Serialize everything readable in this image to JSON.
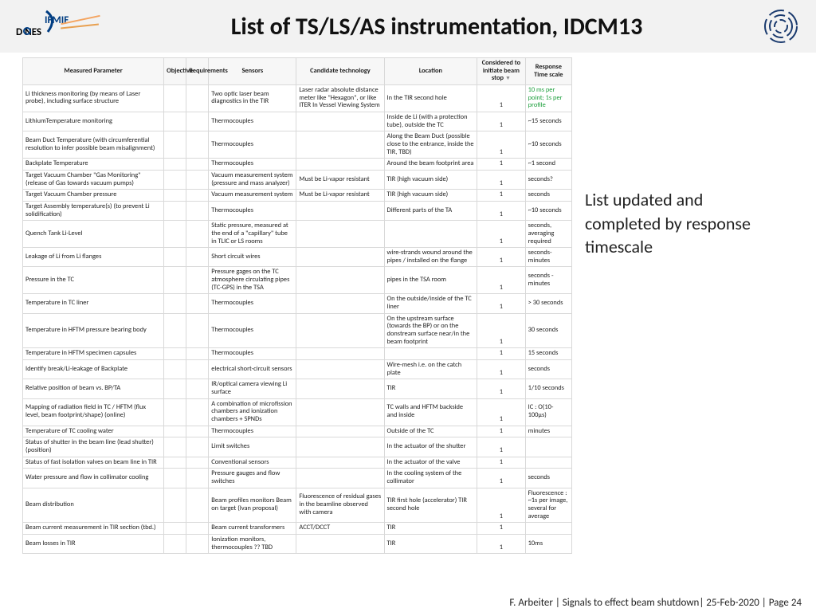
{
  "header": {
    "title": "List of TS/LS/AS instrumentation, IDCM13"
  },
  "sideNote": "List updated and completed by response timescale",
  "footer": "F. Arbeiter | Signals to effect beam shutdown| 25-Feb-2020 | Page 24",
  "logo": {
    "ifmif": "IFMIF",
    "dones": "D   NES"
  },
  "columns": {
    "c1": "Measured Parameter",
    "c2": "Objective",
    "c3": "Requirements",
    "c4": "Sensors",
    "c5": "Candidate technology",
    "c6": "Location",
    "c7": "Considered to initiate beam stop",
    "c8": "Response Time scale"
  },
  "rows": [
    {
      "p": "Li thickness monitoring  (by means of Laser probe), including surface structure",
      "s": "Two optic laser beam diagnostics in the TIR",
      "t": "Laser radar absolute distance meter like \"Hexagon\", or like ITER In Vessel Viewing System",
      "l": "In the TIR second hole",
      "b": "1",
      "r": "10 ms per point; 1s per profile",
      "g": true
    },
    {
      "p": "LithiumTemperature monitoring",
      "s": "Thermocouples",
      "t": "",
      "l": "Inside de Li (with a protection tube), outside the TC",
      "b": "1",
      "r": "~15 seconds"
    },
    {
      "p": "Beam Duct Temperature (with circumferential resolution to infer possible beam misalignment)",
      "s": "Thermocouples",
      "t": "",
      "l": "Along the Beam Duct (possible close to the entrance, inside the TIR, TBD)",
      "b": "1",
      "r": "~10 seconds"
    },
    {
      "p": "Backplate Temperature",
      "s": "Thermocouples",
      "t": "",
      "l": "Around the beam footprint area",
      "b": "1",
      "r": "~1 second"
    },
    {
      "p": "Target Vacuum Chamber \"Gas Monitoring\" (release of Gas towards vacuum pumps)",
      "s": "Vacuum measurement system (pressure and mass analyzer)",
      "t": "Must be Li-vapor resistant",
      "l": "TIR (high vacuum side)",
      "b": "1",
      "r": "seconds?"
    },
    {
      "p": "Target Vacuum Chamber pressure",
      "s": "Vacuum measurement system",
      "t": "Must be Li-vapor resistant",
      "l": "TIR (high vacuum side)",
      "b": "1",
      "r": "seconds"
    },
    {
      "p": "Target Assembly temperature(s) (to prevent Li solidification)",
      "s": "Thermocouples",
      "t": "",
      "l": "Different parts of the TA",
      "b": "1",
      "r": "~10 seconds"
    },
    {
      "p": "Quench Tank Li-Level",
      "s": "Static pressure, measured at the end of a \"capillary\" tube in TLIC or LS rooms",
      "t": "",
      "l": "",
      "b": "1",
      "r": "seconds, averaging required"
    },
    {
      "p": "Leakage of Li from Li flanges",
      "s": "Short circuit wires",
      "t": "",
      "l": "wire-strands wound around the pipes / installed on the flange",
      "b": "1",
      "r": "seconds-minutes"
    },
    {
      "p": "Pressure in the TC",
      "s": "Pressure gages on the TC atmosphere circulating pipes (TC-GPS) in the TSA",
      "t": "",
      "l": "pipes in the TSA room",
      "b": "1",
      "r": "seconds - minutes"
    },
    {
      "p": "Temperature in TC liner",
      "s": "Thermocouples",
      "t": "",
      "l": "On the outside/inside of the TC liner",
      "b": "1",
      "r": "> 30 seconds"
    },
    {
      "p": "Temperature in HFTM pressure bearing body",
      "s": "Thermocouples",
      "t": "",
      "l": "On the upstream surface (towards the BP) or on the donstream surface near/in the beam footprint",
      "b": "1",
      "r": "30 seconds"
    },
    {
      "p": "Temperature in HFTM specimen capsules",
      "s": "Thermocouples",
      "t": "",
      "l": "",
      "b": "1",
      "r": "15 seconds"
    },
    {
      "p": "Identify break/Li-leakage of Backplate",
      "s": "electrical short-circuit sensors",
      "t": "",
      "l": "Wire-mesh i.e. on the catch plate",
      "b": "1",
      "r": "seconds"
    },
    {
      "p": "Relative position of beam vs. BP/TA",
      "s": "IR/optical camera viewing Li surface",
      "t": "",
      "l": "TIR",
      "b": "1",
      "r": "1/10 seconds"
    },
    {
      "p": "Mapping of radiation field in TC / HFTM (flux level, beam footprint/shape) (online)",
      "s": "A combination of microfission chambers and ionization chambers + SPNDs",
      "t": "",
      "l": "TC walls and HFTM backside and inside",
      "b": "1",
      "r": "IC : O(10-100µs)"
    },
    {
      "p": "Temperature of TC cooling water",
      "s": "Thermocouples",
      "t": "",
      "l": "Outside of the TC",
      "b": "1",
      "r": "minutes"
    },
    {
      "p": "Status of shutter in the beam line (lead shutter) (position)",
      "s": "Limit switches",
      "t": "",
      "l": "In the actuator of the shutter",
      "b": "1",
      "r": ""
    },
    {
      "p": "Status of fast isolation valves on beam line  in TIR",
      "s": "Conventional sensors",
      "t": "",
      "l": "In the actuator of the valve",
      "b": "1",
      "r": ""
    },
    {
      "p": "Water pressure and flow in collimator cooling",
      "s": "Pressure gauges and flow switches",
      "t": "",
      "l": "In the cooling system of the collimator",
      "b": "1",
      "r": "seconds"
    },
    {
      "p": "Beam distribution",
      "s": "Beam profiles monitors\nBeam on target (Ivan proposal)",
      "t": "Fluorescence of residual gases in the beamline observed with camera",
      "l": "TIR first hole (accelerator)\nTIR second hole",
      "b": "1",
      "r": "Fluorescence : ~1s per image, several for average"
    },
    {
      "p": "Beam current measurement in TIR section (tbd.)",
      "s": "Beam current transformers",
      "t": "ACCT/DCCT",
      "l": "TIR",
      "b": "1",
      "r": ""
    },
    {
      "p": "Beam losses in TIR",
      "s": "Ionization monitors, thermocouples ?? TBD",
      "t": "",
      "l": "TIR",
      "b": "1",
      "r": "10ms"
    }
  ]
}
